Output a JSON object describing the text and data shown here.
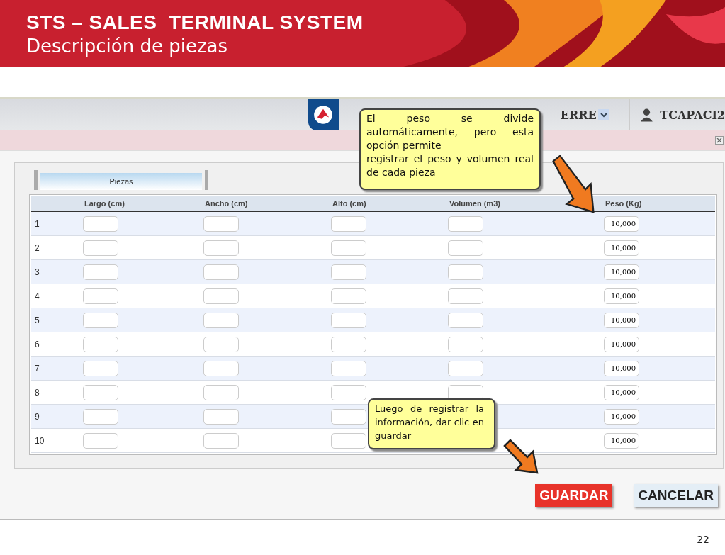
{
  "slide": {
    "title": "STS – SALES  TERMINAL SYSTEM",
    "subtitle": "Descripción de piezas",
    "page_number": "22"
  },
  "app_bar": {
    "user_field": "ERRE",
    "user": "TCAPACI2"
  },
  "tabs": [
    {
      "label": "Piezas",
      "selected": true
    }
  ],
  "table": {
    "columns": [
      "",
      "Largo (cm)",
      "Ancho (cm)",
      "Alto (cm)",
      "Volumen (m3)",
      "Peso (Kg)"
    ],
    "rows": [
      {
        "number": "1",
        "peso": "10,000"
      },
      {
        "number": "2",
        "peso": "10,000"
      },
      {
        "number": "3",
        "peso": "10,000"
      },
      {
        "number": "4",
        "peso": "10,000"
      },
      {
        "number": "5",
        "peso": "10,000"
      },
      {
        "number": "6",
        "peso": "10,000"
      },
      {
        "number": "7",
        "peso": "10,000"
      },
      {
        "number": "8",
        "peso": "10,000"
      },
      {
        "number": "9",
        "peso": "10,000",
        "volume_input": false
      },
      {
        "number": "10",
        "peso": "10,000",
        "volume_input": false
      }
    ]
  },
  "buttons": [
    {
      "label": "GUARDAR",
      "kind": "primary"
    },
    {
      "label": "CANCELAR",
      "kind": "secondary"
    }
  ],
  "callouts": [
    {
      "text": "El peso se divide automáticamente, pero esta opción permite\nregistrar el peso y volumen real de cada pieza",
      "kind": "weight"
    },
    {
      "text": "Luego de registrar la información, dar clic en guardar",
      "kind": "save"
    }
  ]
}
